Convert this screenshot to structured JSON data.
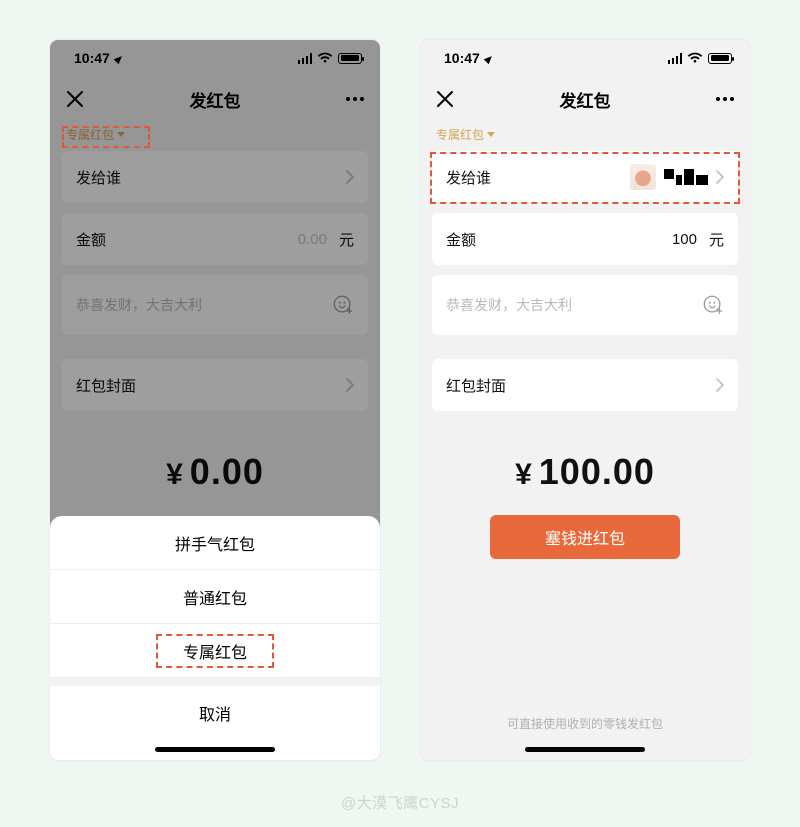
{
  "status": {
    "time": "10:47"
  },
  "header": {
    "title": "发红包"
  },
  "typeLink": "专属红包",
  "labels": {
    "recipient": "发给谁",
    "amount": "金额",
    "unit": "元",
    "msgPlaceholder": "恭喜发财，大吉大利",
    "cover": "红包封面"
  },
  "left": {
    "amountValue": "0.00",
    "bigAmount": "0.00"
  },
  "right": {
    "amountValue": "100",
    "bigAmount": "100.00",
    "cta": "塞钱进红包",
    "footnote": "可直接使用收到的零钱发红包"
  },
  "sheet": {
    "options": [
      "拼手气红包",
      "普通红包",
      "专属红包"
    ],
    "cancel": "取消"
  },
  "watermark": "@大漠飞鹰CYSJ"
}
